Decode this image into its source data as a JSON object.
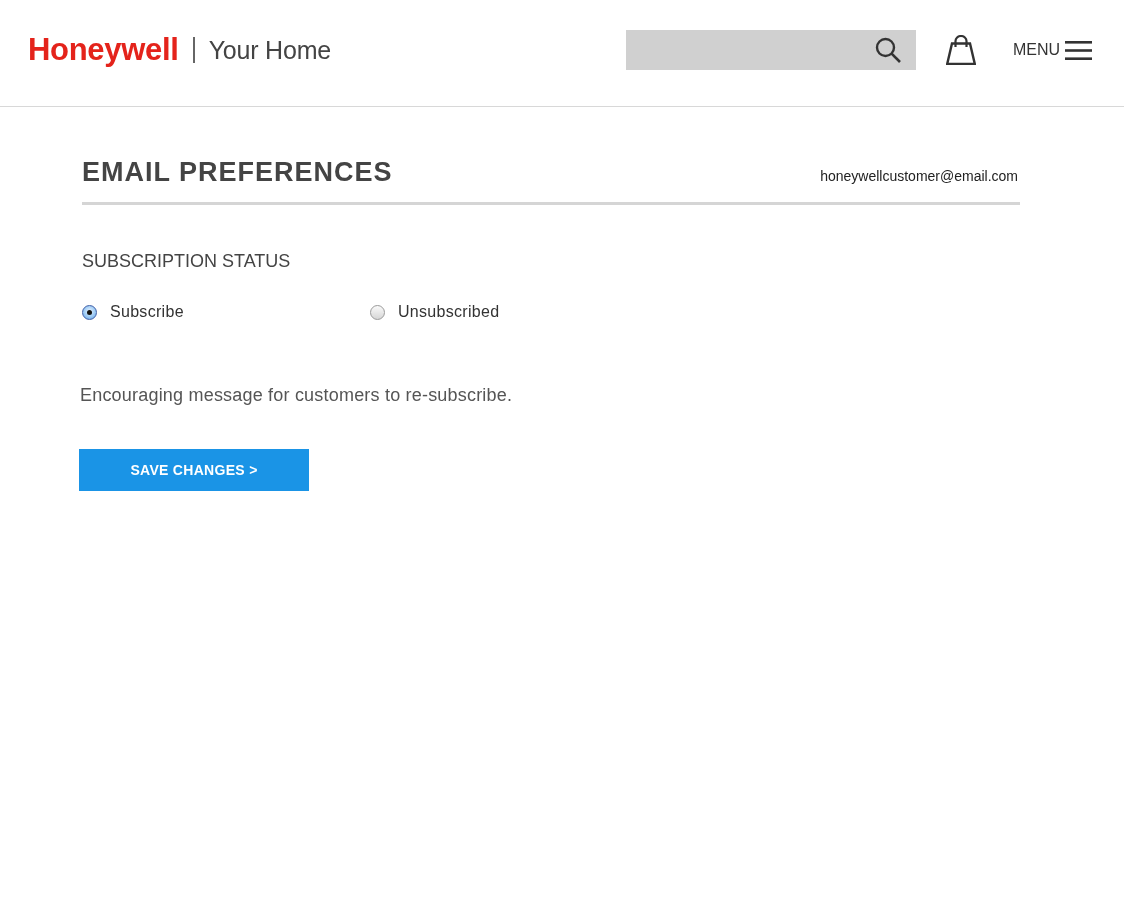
{
  "header": {
    "brand": "Honeywell",
    "tagline": "Your Home",
    "menu_label": "MENU"
  },
  "page": {
    "title": "EMAIL PREFERENCES",
    "email": "honeywellcustomer@email.com"
  },
  "subscription": {
    "label": "SUBSCRIPTION STATUS",
    "options": [
      {
        "label": "Subscribe",
        "selected": true
      },
      {
        "label": "Unsubscribed",
        "selected": false
      }
    ]
  },
  "message": "Encouraging message for customers to re-subscribe.",
  "save_button": {
    "label": "SAVE CHANGES >"
  }
}
